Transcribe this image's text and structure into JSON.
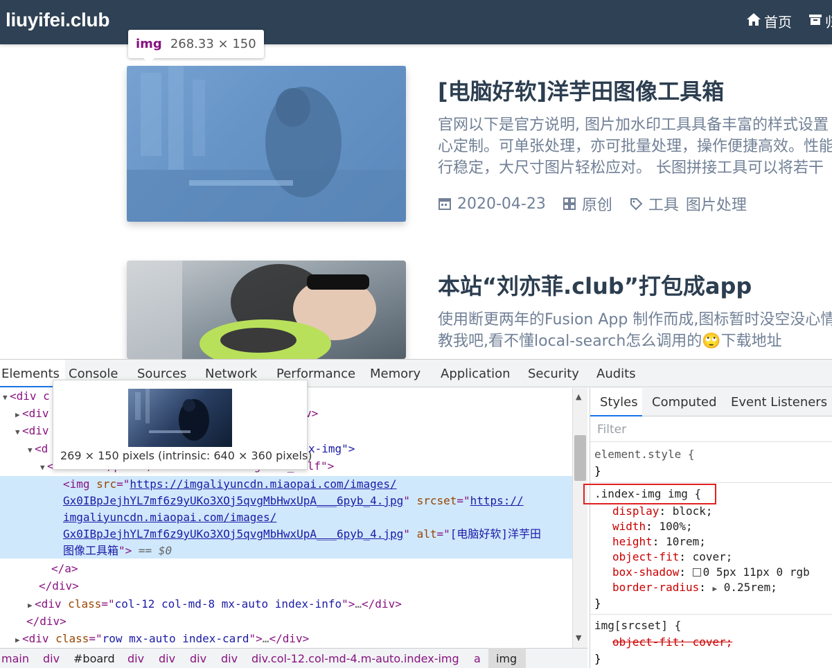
{
  "navbar": {
    "brand": "liuyifei.club",
    "items": [
      {
        "icon": "home-icon",
        "label": "首页"
      },
      {
        "icon": "archive-icon",
        "label": "归"
      }
    ]
  },
  "highlight_tooltip": {
    "tag": "img",
    "size": "268.33 × 150"
  },
  "posts": [
    {
      "title": "[电脑好软]洋芋田图像工具箱",
      "excerpt_lines": [
        "官网以下是官方说明, 图片加水印工具具备丰富的样式设置",
        "心定制。可单张处理，亦可批量处理，操作便捷高效。性能",
        "行稳定，大尺寸图片轻松应对。 长图拼接工具可以将若干"
      ],
      "date": "2020-04-23",
      "category": "原创",
      "tags": [
        "工具",
        "图片处理"
      ]
    },
    {
      "title": "本站“刘亦菲.club”打包成app",
      "excerpt_lines": [
        "使用断更两年的Fusion App 制作而成,图标暂时没空没心情",
        "教我吧,看不懂local-search怎么调用的🙄下载地址"
      ]
    }
  ],
  "devtools": {
    "tabs": [
      "Elements",
      "Console",
      "Sources",
      "Network",
      "Performance",
      "Memory",
      "Application",
      "Security",
      "Audits"
    ],
    "active_tab": "Elements",
    "image_preview": {
      "caption": "269 × 150 pixels (intrinsic: 640 × 360 pixels)"
    },
    "dom": {
      "l1_tag": "<div c",
      "l2_open": "<div",
      "l2_close": "v>",
      "l3": "<div",
      "l4_a": "<d",
      "l4_b": "x-img\">",
      "l5_a": "<a href=\"/posts/35707.html\" target=\"_self\">",
      "l5_b": "_self\">",
      "img_tag": "<img",
      "src_attr": "src",
      "src_val_1": "https://imgaliyuncdn.miaopai.com/images/",
      "src_val_2": "Gx0IBpJejhYL7mf6z9yUKo3XOj5qvgMbHwxUpA___6pyb_4.jpg",
      "srcset_attr": "srcset",
      "srcset_val_1": "https://",
      "srcset_val_2": "imgaliyuncdn.miaopai.com/images/",
      "srcset_val_3": "Gx0IBpJejhYL7mf6z9yUKo3XOj5qvgMbHwxUpA___6pyb_4.jpg",
      "alt_attr": "alt",
      "alt_val_1": "[电脑好软]洋芋田",
      "alt_val_2": "图像工具箱",
      "eq": " == $0",
      "close_a": "</a>",
      "close_div": "</div>",
      "info_div_attr": "class",
      "info_div_val": "col-12 col-md-8 mx-auto index-info",
      "ellipsis": "…",
      "close_div2": "</div>",
      "card_div_val": "row mx-auto index-card"
    },
    "breadcrumb": [
      "main",
      "div",
      "#board",
      "div",
      "div",
      "div",
      "div",
      "div.col-12.col-md-4.m-auto.index-img",
      "a",
      "img"
    ],
    "styles_tabs": [
      "Styles",
      "Computed",
      "Event Listeners"
    ],
    "filter_placeholder": "Filter",
    "rules": {
      "element_style": "element.style {",
      "close": "}",
      "index_selector": ".index-img img {",
      "props": [
        {
          "name": "display",
          "value": "block;"
        },
        {
          "name": "width",
          "value": "100%;"
        },
        {
          "name": "height",
          "value": "10rem;"
        },
        {
          "name": "object-fit",
          "value": "cover;"
        },
        {
          "name": "box-shadow",
          "value": "0 5px 11px 0 rgb"
        },
        {
          "name": "border-radius",
          "value": "0.25rem;"
        }
      ],
      "srcset_selector": "img[srcset] {",
      "srcset_prop": "object-fit: cover;"
    }
  }
}
